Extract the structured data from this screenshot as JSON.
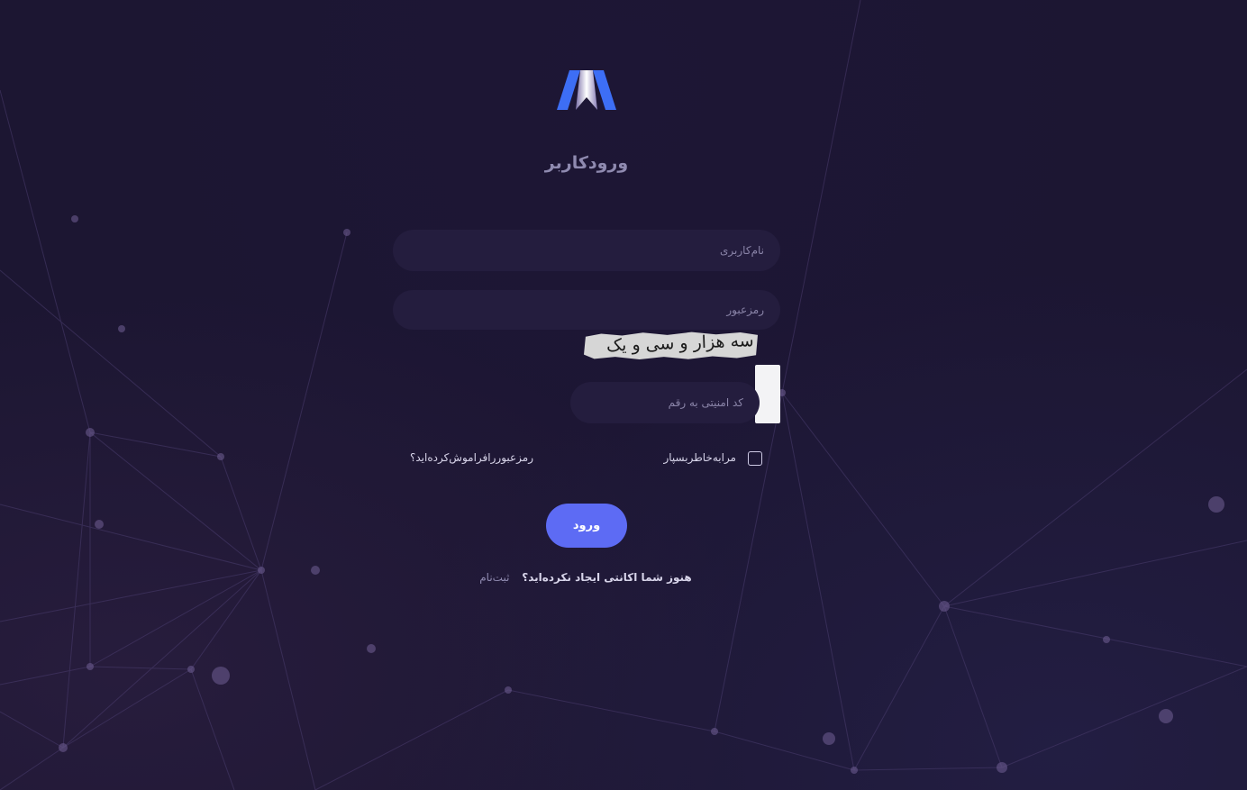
{
  "title": "ورودکاربر",
  "username": {
    "placeholder": "نام‌کاربری",
    "value": ""
  },
  "password": {
    "placeholder": "رمزعبور",
    "value": ""
  },
  "captcha": {
    "image_text": "سه هزار و سی و یک",
    "input_placeholder": "کد امنیتی به رقم",
    "value": ""
  },
  "remember_me": {
    "label": "مرابه‌خاطربسپار",
    "checked": false
  },
  "forgot_password": "رمزعبوررافراموش‌کرده‌اید؟",
  "login_button": "ورود",
  "signup": {
    "question": "هنوز شما اکانتی ایجاد نکرده‌اید؟",
    "link": "ثبت‌نام"
  },
  "colors": {
    "background": "#1c1632",
    "field_bg": "#241d3e",
    "primary_button": "#5d6bf4",
    "logo_blue": "#3d6ef5"
  }
}
